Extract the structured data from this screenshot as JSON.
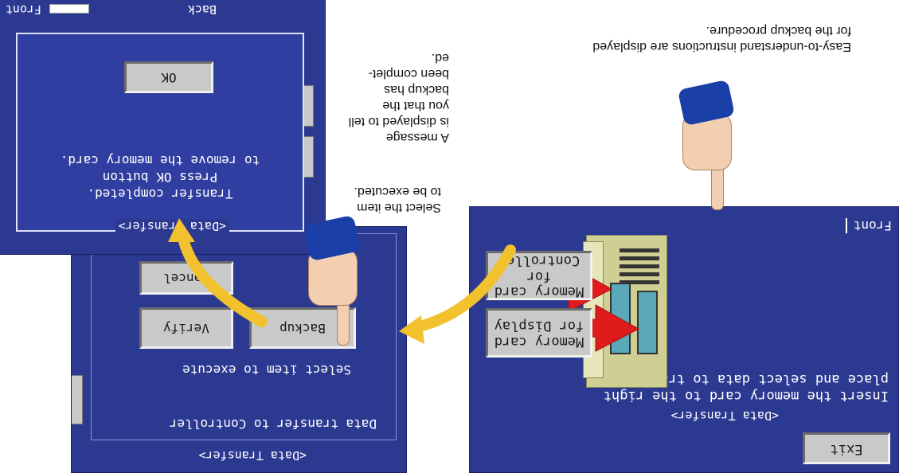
{
  "screen_main": {
    "exit_label": "Exit",
    "title": "<Data Transfer>",
    "instruction": "Insert the memory card to the right\nplace and select data to transmit.",
    "btn_display_card": "Memory card\nfor Display",
    "btn_controller_card": "Memory card\nfor Controller",
    "front_label": "Front"
  },
  "screen_select": {
    "title": "<Data Transfer>",
    "line1": "Data transfer to Controller",
    "line2": "Select item to execute",
    "btn_backup": "Backup",
    "btn_verify": "Verify",
    "btn_cancel": "Cancel"
  },
  "screen_done": {
    "title": "<Data Transfer>",
    "message": "Transfer completed.\nPress OK button\nto remove the memory card.",
    "btn_ok": "OK",
    "back_label": "Back",
    "front_label": "Front"
  },
  "annotations": {
    "easy": "Easy-to-understand instructions are displayed\nfor the backup procedure.",
    "select_item": "Select the item\nto be executed.",
    "message": "A message\nis displayed to tell\nyou that the\nbackup has\nbeen complet-\ned."
  },
  "colors": {
    "screen_bg": "#2c3991",
    "button_face": "#c9c9c9",
    "arrow_red": "#e01b1b",
    "arrow_yellow": "#f2c12e"
  }
}
